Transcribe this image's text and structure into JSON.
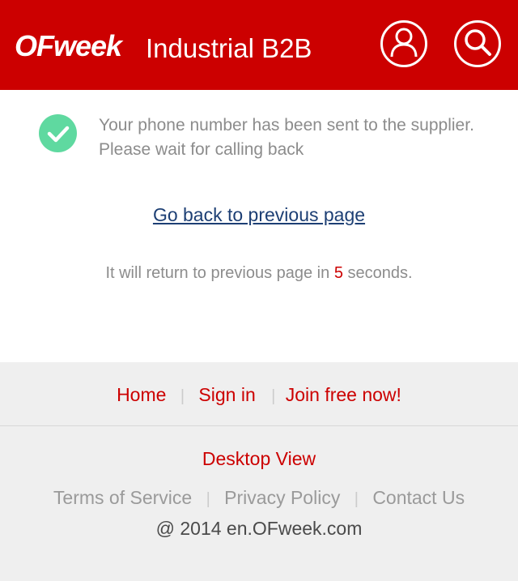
{
  "header": {
    "logo_text": "OFweek",
    "site_title": "Industrial B2B",
    "user_icon": "user-icon",
    "search_icon": "search-icon",
    "background_color": "#cc0000"
  },
  "notice": {
    "icon": "check-circle-icon",
    "icon_color": "#5fd9a0",
    "line1": "Your phone number has been sent to the supplier.",
    "line2": "Please wait for calling back"
  },
  "back_link": {
    "label": "Go back to previous page"
  },
  "countdown": {
    "prefix": "It will return to previous page in",
    "seconds": "5",
    "suffix": "seconds."
  },
  "footer": {
    "nav": {
      "home": "Home",
      "sign_in": "Sign in",
      "join": "Join free now!",
      "separator": "|"
    },
    "desktop_view": "Desktop View",
    "legal": {
      "terms": "Terms of Service",
      "privacy": "Privacy Policy",
      "contact": "Contact Us"
    },
    "copyright": "@ 2014 en.OFweek.com"
  }
}
